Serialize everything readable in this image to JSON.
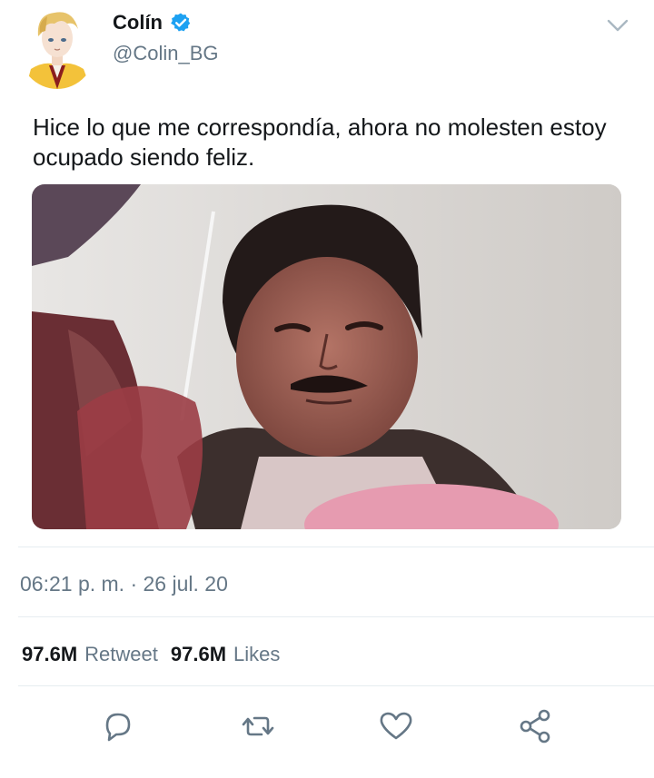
{
  "user": {
    "name": "Colín",
    "handle": "@Colin_BG",
    "verified": true
  },
  "tweet": {
    "text": "Hice lo que me correspondía, ahora no molesten estoy ocupado siendo feliz.",
    "timestamp": "06:21 p. m. · 26 jul. 20"
  },
  "stats": {
    "retweet_count": "97.6M",
    "retweet_label": "Retweet",
    "likes_count": "97.6M",
    "likes_label": "Likes"
  },
  "icons": {
    "more": "chevron-down-icon",
    "reply": "reply-icon",
    "retweet": "retweet-icon",
    "like": "heart-icon",
    "share": "share-icon"
  },
  "colors": {
    "verified": "#1da1f2",
    "secondary_text": "#657786",
    "divider": "#e6ecf0"
  }
}
